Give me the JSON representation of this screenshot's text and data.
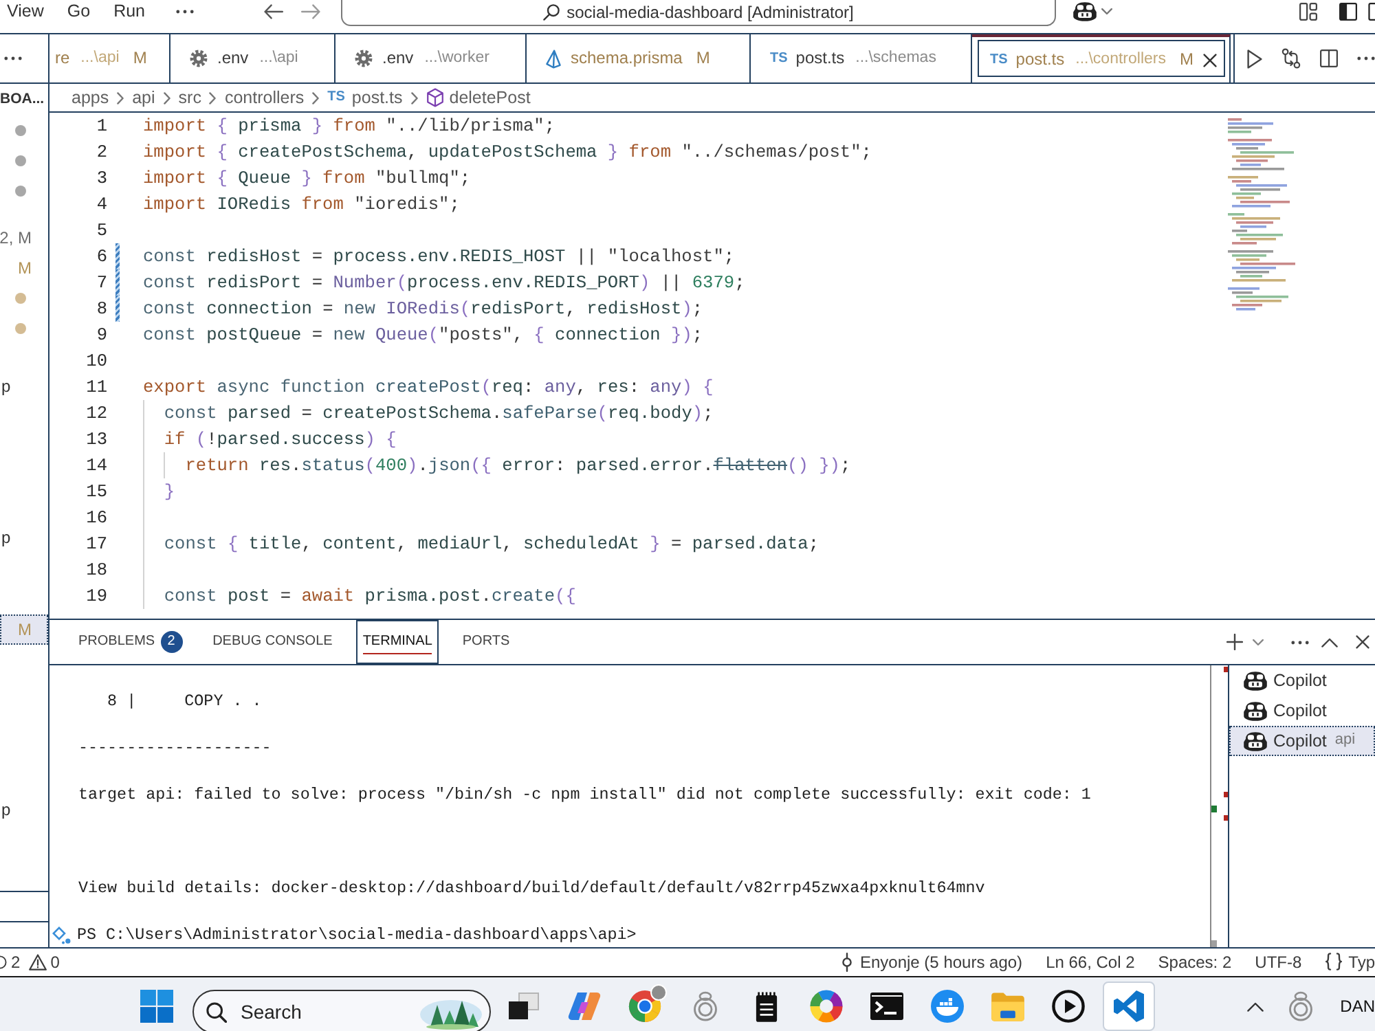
{
  "title_bar": {
    "menus": [
      "View",
      "Go",
      "Run"
    ],
    "command_center": "social-media-dashboard [Administrator]"
  },
  "explorer": {
    "title": "BOA...",
    "items": [
      {
        "kind": "dot",
        "color": "#a8a8a8",
        "selected": false
      },
      {
        "kind": "dot",
        "color": "#a8a8a8",
        "selected": false
      },
      {
        "kind": "dot",
        "color": "#a8a8a8",
        "selected": false
      },
      {
        "kind": "badge",
        "text": "2, M",
        "color": "#6e6e6e",
        "selected": false
      },
      {
        "kind": "badge",
        "text": "M",
        "color": "#b39458",
        "selected": false
      },
      {
        "kind": "dot",
        "color": "#d4bc94",
        "selected": false
      },
      {
        "kind": "dot",
        "color": "#d4bc94",
        "selected": false
      },
      {
        "kind": "label",
        "text": "p",
        "selected": false
      },
      {
        "kind": "label",
        "text": "p",
        "selected": false
      },
      {
        "kind": "badge",
        "text": "M",
        "color": "#b39458",
        "selected": true
      },
      {
        "kind": "label",
        "text": "p",
        "selected": false
      }
    ]
  },
  "tabs": [
    {
      "kind": "plain",
      "name": "re",
      "description": "...\\api",
      "status": "M",
      "modified": true,
      "selected": false
    },
    {
      "kind": "settings",
      "name": ".env",
      "description": "...\\api",
      "modified": false,
      "selected": false
    },
    {
      "kind": "settings",
      "name": ".env",
      "description": "...\\worker",
      "modified": false,
      "selected": false
    },
    {
      "kind": "prisma",
      "name": "schema.prisma",
      "status": "M",
      "modified": true,
      "selected": false
    },
    {
      "kind": "typescript",
      "file_badge": "TS",
      "name": "post.ts",
      "description": "...\\schemas",
      "modified": false,
      "selected": false
    },
    {
      "kind": "typescript",
      "file_badge": "TS",
      "name": "post.ts",
      "description": "...\\controllers",
      "status": "M",
      "modified": true,
      "selected": true
    }
  ],
  "breadcrumb": [
    {
      "kind": "folder",
      "label": "apps"
    },
    {
      "kind": "folder",
      "label": "api"
    },
    {
      "kind": "folder",
      "label": "src"
    },
    {
      "kind": "folder",
      "label": "controllers"
    },
    {
      "kind": "file",
      "file_badge": "TS",
      "label": "post.ts"
    },
    {
      "kind": "symbol",
      "label": "deletePost"
    }
  ],
  "editor": {
    "lines": [
      {
        "number": "1",
        "changed": false,
        "tokens": [
          {
            "kind": "kw",
            "text": "import"
          },
          {
            "kind": "br",
            "text": " {"
          },
          {
            "kind": "var",
            "text": " prisma"
          },
          {
            "kind": "br",
            "text": " }"
          },
          {
            "kind": "kw",
            "text": " from"
          },
          {
            "kind": "str",
            "text": " \"../lib/prisma\""
          },
          {
            "kind": "punct",
            "text": ";"
          }
        ]
      },
      {
        "number": "2",
        "changed": false,
        "tokens": [
          {
            "kind": "kw",
            "text": "import"
          },
          {
            "kind": "br",
            "text": " {"
          },
          {
            "kind": "var",
            "text": " createPostSchema"
          },
          {
            "kind": "punct",
            "text": ","
          },
          {
            "kind": "var",
            "text": " updatePostSchema"
          },
          {
            "kind": "br",
            "text": " }"
          },
          {
            "kind": "kw",
            "text": " from"
          },
          {
            "kind": "str",
            "text": " \"../schemas/post\""
          },
          {
            "kind": "punct",
            "text": ";"
          }
        ]
      },
      {
        "number": "3",
        "changed": false,
        "tokens": [
          {
            "kind": "kw",
            "text": "import"
          },
          {
            "kind": "br",
            "text": " {"
          },
          {
            "kind": "var",
            "text": " Queue"
          },
          {
            "kind": "br",
            "text": " }"
          },
          {
            "kind": "kw",
            "text": " from"
          },
          {
            "kind": "str",
            "text": " \"bullmq\""
          },
          {
            "kind": "punct",
            "text": ";"
          }
        ]
      },
      {
        "number": "4",
        "changed": false,
        "tokens": [
          {
            "kind": "kw",
            "text": "import"
          },
          {
            "kind": "var",
            "text": " IORedis"
          },
          {
            "kind": "kw",
            "text": " from"
          },
          {
            "kind": "str",
            "text": " \"ioredis\""
          },
          {
            "kind": "punct",
            "text": ";"
          }
        ]
      },
      {
        "number": "5",
        "changed": false
      },
      {
        "number": "6",
        "changed": true,
        "tokens": [
          {
            "kind": "storage",
            "text": "const"
          },
          {
            "kind": "var",
            "text": " redisHost"
          },
          {
            "kind": "punct",
            "text": " ="
          },
          {
            "kind": "var",
            "text": " process.env.REDIS_HOST"
          },
          {
            "kind": "punct",
            "text": " ||"
          },
          {
            "kind": "str",
            "text": " \"localhost\""
          },
          {
            "kind": "punct",
            "text": ";"
          }
        ]
      },
      {
        "number": "7",
        "changed": true,
        "tokens": [
          {
            "kind": "storage",
            "text": "const"
          },
          {
            "kind": "var",
            "text": " redisPort"
          },
          {
            "kind": "punct",
            "text": " ="
          },
          {
            "kind": "type",
            "text": " Number"
          },
          {
            "kind": "br",
            "text": "("
          },
          {
            "kind": "var",
            "text": "process.env.REDIS_PORT"
          },
          {
            "kind": "br",
            "text": ")"
          },
          {
            "kind": "punct",
            "text": " ||"
          },
          {
            "kind": "num",
            "text": " 6379"
          },
          {
            "kind": "punct",
            "text": ";"
          }
        ]
      },
      {
        "number": "8",
        "changed": true,
        "tokens": [
          {
            "kind": "storage",
            "text": "const"
          },
          {
            "kind": "var",
            "text": " connection"
          },
          {
            "kind": "punct",
            "text": " ="
          },
          {
            "kind": "storage",
            "text": " new"
          },
          {
            "kind": "type",
            "text": " IORedis"
          },
          {
            "kind": "br",
            "text": "("
          },
          {
            "kind": "var",
            "text": "redisPort"
          },
          {
            "kind": "punct",
            "text": ","
          },
          {
            "kind": "var",
            "text": " redisHost"
          },
          {
            "kind": "br",
            "text": ")"
          },
          {
            "kind": "punct",
            "text": ";"
          }
        ]
      },
      {
        "number": "9",
        "changed": false,
        "tokens": [
          {
            "kind": "storage",
            "text": "const"
          },
          {
            "kind": "var",
            "text": " postQueue"
          },
          {
            "kind": "punct",
            "text": " ="
          },
          {
            "kind": "storage",
            "text": " new"
          },
          {
            "kind": "type",
            "text": " Queue"
          },
          {
            "kind": "br",
            "text": "("
          },
          {
            "kind": "str",
            "text": "\"posts\""
          },
          {
            "kind": "punct",
            "text": ","
          },
          {
            "kind": "br",
            "text": " {"
          },
          {
            "kind": "var",
            "text": " connection"
          },
          {
            "kind": "br",
            "text": " })"
          },
          {
            "kind": "punct",
            "text": ";"
          }
        ]
      },
      {
        "number": "10",
        "changed": false
      },
      {
        "number": "11",
        "changed": false,
        "tokens": [
          {
            "kind": "kw",
            "text": "export"
          },
          {
            "kind": "storage",
            "text": " async"
          },
          {
            "kind": "storage",
            "text": " function"
          },
          {
            "kind": "fn",
            "text": " createPost"
          },
          {
            "kind": "br",
            "text": "("
          },
          {
            "kind": "var",
            "text": "req"
          },
          {
            "kind": "punct",
            "text": ":"
          },
          {
            "kind": "type",
            "text": " any"
          },
          {
            "kind": "punct",
            "text": ","
          },
          {
            "kind": "var",
            "text": " res"
          },
          {
            "kind": "punct",
            "text": ":"
          },
          {
            "kind": "type",
            "text": " any"
          },
          {
            "kind": "br",
            "text": ") {"
          }
        ]
      },
      {
        "number": "12",
        "changed": false,
        "tokens": [
          {
            "kind": "storage",
            "text": "  const"
          },
          {
            "kind": "var",
            "text": " parsed"
          },
          {
            "kind": "punct",
            "text": " ="
          },
          {
            "kind": "var",
            "text": " createPostSchema"
          },
          {
            "kind": "punct",
            "text": "."
          },
          {
            "kind": "fn",
            "text": "safeParse"
          },
          {
            "kind": "br",
            "text": "("
          },
          {
            "kind": "var",
            "text": "req.body"
          },
          {
            "kind": "br",
            "text": ")"
          },
          {
            "kind": "punct",
            "text": ";"
          }
        ]
      },
      {
        "number": "13",
        "changed": false,
        "tokens": [
          {
            "kind": "kw",
            "text": "  if"
          },
          {
            "kind": "br",
            "text": " ("
          },
          {
            "kind": "punct",
            "text": "!"
          },
          {
            "kind": "var",
            "text": "parsed.success"
          },
          {
            "kind": "br",
            "text": ") {"
          }
        ]
      },
      {
        "number": "14",
        "changed": false,
        "tokens": [
          {
            "kind": "kw",
            "text": "    return"
          },
          {
            "kind": "var",
            "text": " res"
          },
          {
            "kind": "punct",
            "text": "."
          },
          {
            "kind": "fn",
            "text": "status"
          },
          {
            "kind": "br",
            "text": "("
          },
          {
            "kind": "num",
            "text": "400"
          },
          {
            "kind": "br",
            "text": ")"
          },
          {
            "kind": "punct",
            "text": "."
          },
          {
            "kind": "fn",
            "text": "json"
          },
          {
            "kind": "br",
            "text": "({"
          },
          {
            "kind": "var",
            "text": " error"
          },
          {
            "kind": "punct",
            "text": ":"
          },
          {
            "kind": "var",
            "text": " parsed.error"
          },
          {
            "kind": "punct",
            "text": "."
          },
          {
            "kind": "deprecated",
            "text": "flatten"
          },
          {
            "kind": "br",
            "text": "()"
          },
          {
            "kind": "br",
            "text": " })"
          },
          {
            "kind": "punct",
            "text": ";"
          }
        ]
      },
      {
        "number": "15",
        "changed": false,
        "tokens": [
          {
            "kind": "br",
            "text": "  }"
          }
        ]
      },
      {
        "number": "16",
        "changed": false
      },
      {
        "number": "17",
        "changed": false,
        "tokens": [
          {
            "kind": "storage",
            "text": "  const"
          },
          {
            "kind": "br",
            "text": " {"
          },
          {
            "kind": "var",
            "text": " title"
          },
          {
            "kind": "punct",
            "text": ","
          },
          {
            "kind": "var",
            "text": " content"
          },
          {
            "kind": "punct",
            "text": ","
          },
          {
            "kind": "var",
            "text": " mediaUrl"
          },
          {
            "kind": "punct",
            "text": ","
          },
          {
            "kind": "var",
            "text": " scheduledAt"
          },
          {
            "kind": "br",
            "text": " }"
          },
          {
            "kind": "punct",
            "text": " ="
          },
          {
            "kind": "var",
            "text": " parsed.data"
          },
          {
            "kind": "punct",
            "text": ";"
          }
        ]
      },
      {
        "number": "18",
        "changed": false
      },
      {
        "number": "19",
        "changed": false,
        "tokens": [
          {
            "kind": "storage",
            "text": "  const"
          },
          {
            "kind": "var",
            "text": " post"
          },
          {
            "kind": "punct",
            "text": " ="
          },
          {
            "kind": "kw",
            "text": " await"
          },
          {
            "kind": "var",
            "text": " prisma.post"
          },
          {
            "kind": "punct",
            "text": "."
          },
          {
            "kind": "fn",
            "text": "create"
          },
          {
            "kind": "br",
            "text": "({"
          }
        ]
      }
    ]
  },
  "panel": {
    "tabs": [
      {
        "label": "PROBLEMS",
        "count": "2",
        "selected": false
      },
      {
        "label": "DEBUG CONSOLE",
        "selected": false
      },
      {
        "label": "TERMINAL",
        "selected": true
      },
      {
        "label": "PORTS",
        "selected": false
      }
    ],
    "terminal": {
      "output": [
        "   8 |     COPY . .",
        "--------------------",
        "target api: failed to solve: process \"/bin/sh -c npm install\" did not complete successfully: exit code: 1",
        "View build details: docker-desktop://dashboard/build/default/default/v82rrp45zwxa4pxknult64mnv"
      ],
      "prompt": "PS C:\\Users\\Administrator\\social-media-dashboard\\apps\\api>"
    },
    "terminals": [
      {
        "label": "Copilot",
        "selected": false
      },
      {
        "label": "Copilot",
        "selected": false
      },
      {
        "label": "Copilot",
        "description": "api",
        "selected": true
      }
    ]
  },
  "status_bar": {
    "errors": "2",
    "warnings": "0",
    "blame": "Enyonje (5 hours ago)",
    "cursor": "Ln 66, Col 2",
    "indentation": "Spaces: 2",
    "encoding": "UTF-8",
    "language": "Typ"
  },
  "taskbar": {
    "search": "Search",
    "apps": [
      {
        "kind": "task_view",
        "active": false
      },
      {
        "kind": "assistant",
        "active": false
      },
      {
        "kind": "browser",
        "active": false
      },
      {
        "kind": "ring",
        "active": false
      },
      {
        "kind": "notes",
        "active": false
      },
      {
        "kind": "color_wheel",
        "active": false
      },
      {
        "kind": "terminal",
        "active": false
      },
      {
        "kind": "whale",
        "active": false
      },
      {
        "kind": "folder",
        "active": false
      },
      {
        "kind": "player",
        "active": false
      },
      {
        "kind": "editor",
        "active": true
      }
    ],
    "tray_text": "DAN"
  }
}
